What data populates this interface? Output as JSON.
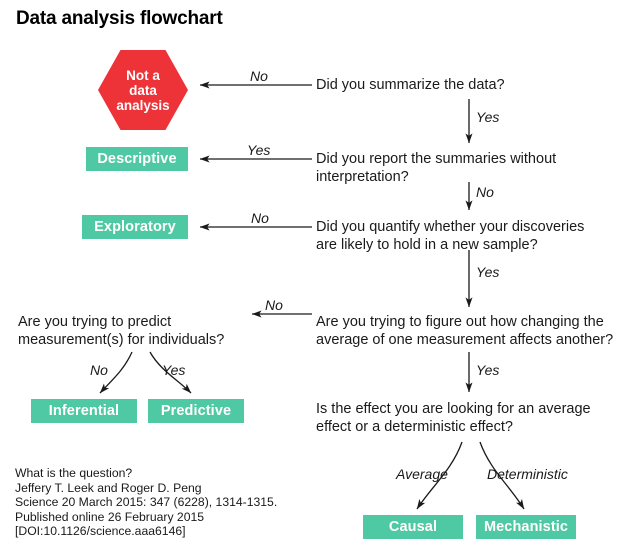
{
  "title": "Data analysis flowchart",
  "colors": {
    "green": "#4FC9A3",
    "red": "#EE3338",
    "text": "#1a1a1a",
    "background": "#ffffff"
  },
  "nodes": {
    "hexagon": {
      "label": "Not a\ndata\nanalysis"
    },
    "questions": [
      {
        "id": "q1",
        "text": "Did you summarize the data?"
      },
      {
        "id": "q2",
        "text": "Did you report the summaries without\ninterpretation?"
      },
      {
        "id": "q3",
        "text": "Did you quantify whether your discoveries\nare likely to hold in a new sample?"
      },
      {
        "id": "q4",
        "text": "Are you trying to figure out how changing the\naverage of one measurement affects another?"
      },
      {
        "id": "q5",
        "text": "Are you trying to predict\nmeasurement(s) for individuals?"
      },
      {
        "id": "q6",
        "text": "Is the effect you are looking for an average\neffect or a deterministic effect?"
      }
    ],
    "outcomes": [
      {
        "id": "descriptive",
        "label": "Descriptive"
      },
      {
        "id": "exploratory",
        "label": "Exploratory"
      },
      {
        "id": "inferential",
        "label": "Inferential"
      },
      {
        "id": "predictive",
        "label": "Predictive"
      },
      {
        "id": "causal",
        "label": "Causal"
      },
      {
        "id": "mechanistic",
        "label": "Mechanistic"
      }
    ]
  },
  "edges": [
    {
      "id": "e1",
      "label": "No",
      "from": "q1",
      "to": "hexagon"
    },
    {
      "id": "e2",
      "label": "Yes",
      "from": "q1",
      "to": "q2"
    },
    {
      "id": "e3",
      "label": "Yes",
      "from": "q2",
      "to": "descriptive"
    },
    {
      "id": "e4",
      "label": "No",
      "from": "q2",
      "to": "q3"
    },
    {
      "id": "e5",
      "label": "No",
      "from": "q3",
      "to": "exploratory"
    },
    {
      "id": "e6",
      "label": "Yes",
      "from": "q3",
      "to": "q4"
    },
    {
      "id": "e7",
      "label": "No",
      "from": "q4",
      "to": "q5"
    },
    {
      "id": "e8",
      "label": "No",
      "from": "q5",
      "to": "inferential"
    },
    {
      "id": "e9",
      "label": "Yes",
      "from": "q5",
      "to": "predictive"
    },
    {
      "id": "e10",
      "label": "Yes",
      "from": "q4",
      "to": "q6"
    },
    {
      "id": "e11",
      "label": "Average",
      "from": "q6",
      "to": "causal"
    },
    {
      "id": "e12",
      "label": "Deterministic",
      "from": "q6",
      "to": "mechanistic"
    }
  ],
  "citation": "What is the question?\nJeffery T. Leek and Roger D. Peng\nScience 20 March 2015: 347 (6228), 1314-1315.\nPublished online 26 February 2015\n[DOI:10.1126/science.aaa6146]"
}
